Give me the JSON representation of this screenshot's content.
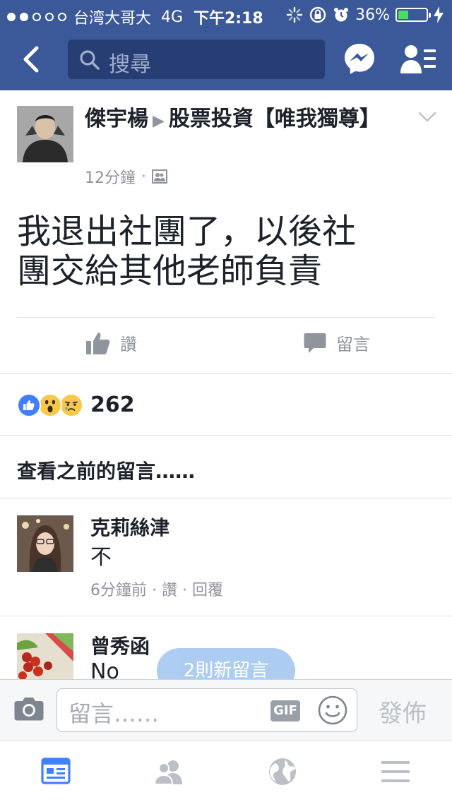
{
  "status_bar": {
    "carrier": "台湾大哥大",
    "network": "4G",
    "time": "下午2:18",
    "battery": "36%",
    "battery_level": 0.36
  },
  "nav": {
    "search_placeholder": "搜尋"
  },
  "post": {
    "author": "傑宇楊",
    "arrow": "▶",
    "group": "股票投資【唯我獨尊】",
    "time": "12分鐘",
    "dot": "·",
    "text_line1": "我退出社團了，以後社",
    "text_line2": "團交給其他老師負責",
    "like_label": "讚",
    "comment_label": "留言"
  },
  "reactions": {
    "count": "262",
    "types": [
      "like-icon",
      "wow-icon",
      "sad-icon"
    ]
  },
  "view_previous": "查看之前的留言……",
  "comments": [
    {
      "name": "克莉絲津",
      "text": "不",
      "time": "6分鐘前",
      "sep": "·",
      "like": "讚",
      "reply": "回覆"
    },
    {
      "name": "曾秀函",
      "text": "No"
    }
  ],
  "new_comments_pill": "2則新留言",
  "composer": {
    "placeholder": "留言……",
    "gif": "GIF",
    "publish": "發佈"
  },
  "colors": {
    "brand": "#3b5998",
    "active_tab": "#4080ff",
    "muted": "#90949c"
  }
}
